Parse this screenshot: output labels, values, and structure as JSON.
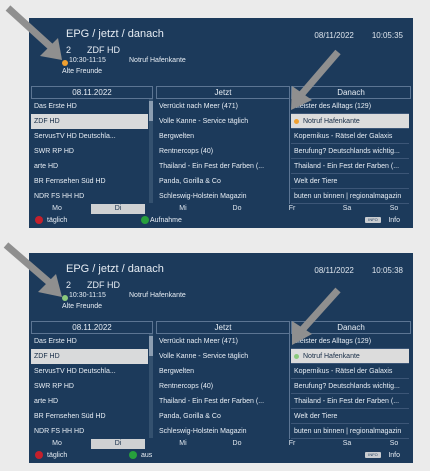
{
  "colors": {
    "panel_bg": "#1c3a5b",
    "selection": "#d9dadb",
    "red": "#c4202c",
    "green": "#27a03c",
    "orange": "#f0a030",
    "arrow": "#8f8f8f"
  },
  "screens": [
    {
      "title": "EPG / jetzt / danach",
      "date": "08/11/2022",
      "clock": "10:05:35",
      "channel_num": "2",
      "channel_name": "ZDF HD",
      "time": "10:30-11:15",
      "program": "Notruf Hafenkante",
      "subtitle": "Alte Freunde",
      "list_date": "08.11.2022",
      "col_now": "Jetzt",
      "col_next": "Danach",
      "channels": [
        "Das Erste HD",
        "ZDF HD",
        "ServusTV HD Deutschla...",
        "SWR RP HD",
        "arte HD",
        "BR Fernsehen Süd HD",
        "NDR FS HH HD"
      ],
      "now": [
        "Verrückt nach Meer (471)",
        "Volle Kanne - Service täglich",
        "Bergwelten",
        "Rentnercops (40)",
        "Thailand - Ein Fest der Farben (...",
        "Panda, Gorilla & Co",
        "Schleswig-Holstein Magazin"
      ],
      "next": [
        "Meister des Alltags (129)",
        "Notruf Hafenkante",
        "Kopernikus - Rätsel der Galaxis",
        "Berufung? Deutschlands wichtig...",
        "Thailand - Ein Fest der Farben (...",
        "Welt der Tiere",
        "buten un binnen | regionalmagazin"
      ],
      "days": [
        "Mo",
        "Di",
        "Mi",
        "Do",
        "Fr",
        "Sa",
        "So"
      ],
      "red_label": "täglich",
      "green_label": "Aufnahme",
      "info_badge": "INFO",
      "info_label": "Info"
    },
    {
      "title": "EPG / jetzt / danach",
      "date": "08/11/2022",
      "clock": "10:05:38",
      "channel_num": "2",
      "channel_name": "ZDF HD",
      "time": "10:30-11:15",
      "program": "Notruf Hafenkante",
      "subtitle": "Alte Freunde",
      "list_date": "08.11.2022",
      "col_now": "Jetzt",
      "col_next": "Danach",
      "channels": [
        "Das Erste HD",
        "ZDF HD",
        "ServusTV HD Deutschla...",
        "SWR RP HD",
        "arte HD",
        "BR Fernsehen Süd HD",
        "NDR FS HH HD"
      ],
      "now": [
        "Verrückt nach Meer (471)",
        "Volle Kanne - Service täglich",
        "Bergwelten",
        "Rentnercops (40)",
        "Thailand - Ein Fest der Farben (...",
        "Panda, Gorilla & Co",
        "Schleswig-Holstein Magazin"
      ],
      "next": [
        "Meister des Alltags (129)",
        "Notruf Hafenkante",
        "Kopernikus - Rätsel der Galaxis",
        "Berufung? Deutschlands wichtig...",
        "Thailand - Ein Fest der Farben (...",
        "Welt der Tiere",
        "buten un binnen | regionalmagazin"
      ],
      "days": [
        "Mo",
        "Di",
        "Mi",
        "Do",
        "Fr",
        "Sa",
        "So"
      ],
      "red_label": "täglich",
      "green_label": "aus",
      "info_badge": "INFO",
      "info_label": "Info"
    }
  ]
}
